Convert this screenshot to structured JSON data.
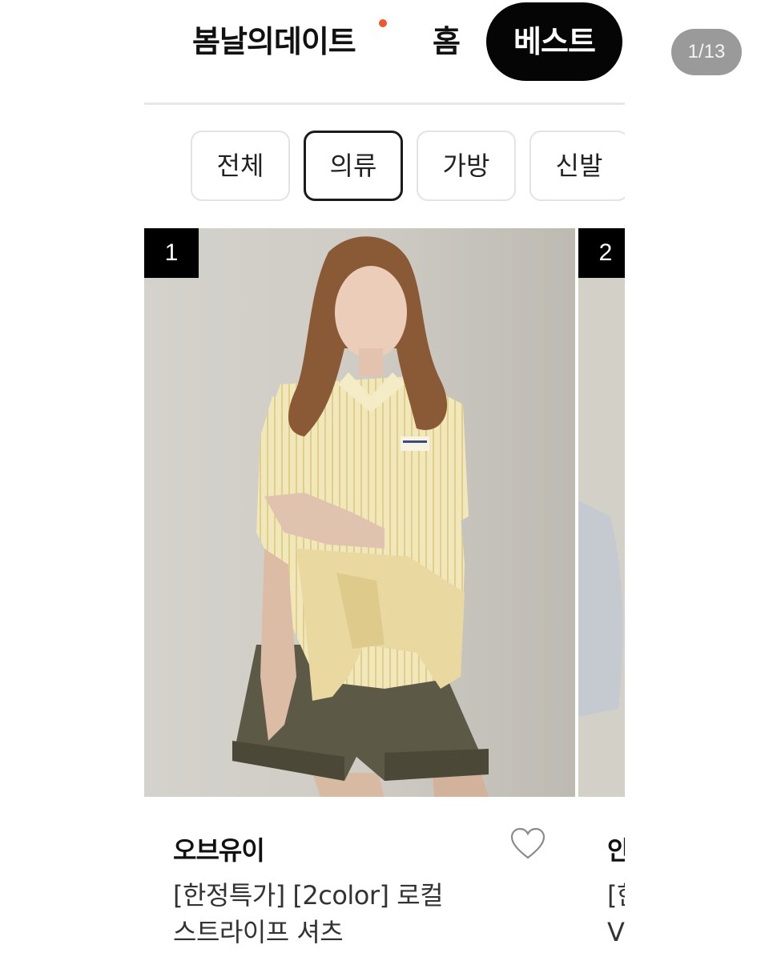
{
  "header": {
    "tabs": [
      {
        "label": "봄날의데이트",
        "new": true
      },
      {
        "label": "홈"
      },
      {
        "label": "베스트",
        "active": true
      }
    ],
    "page_counter": "1/13"
  },
  "categories": [
    "전체",
    "의류",
    "가방",
    "신발"
  ],
  "selected_category": "의류",
  "products": [
    {
      "rank": "1",
      "brand": "오브유이",
      "title_line1": "[한정특가] [2color] 로컬",
      "title_line2": "스트라이프 셔츠",
      "wishlisted": false
    },
    {
      "rank": "2",
      "brand": "안",
      "title_line1": "[한",
      "title_line2": "V"
    }
  ],
  "colors": {
    "active_tab_bg": "#050505",
    "new_dot": "#f0572e",
    "counter_bg": "#9a9a9a"
  }
}
